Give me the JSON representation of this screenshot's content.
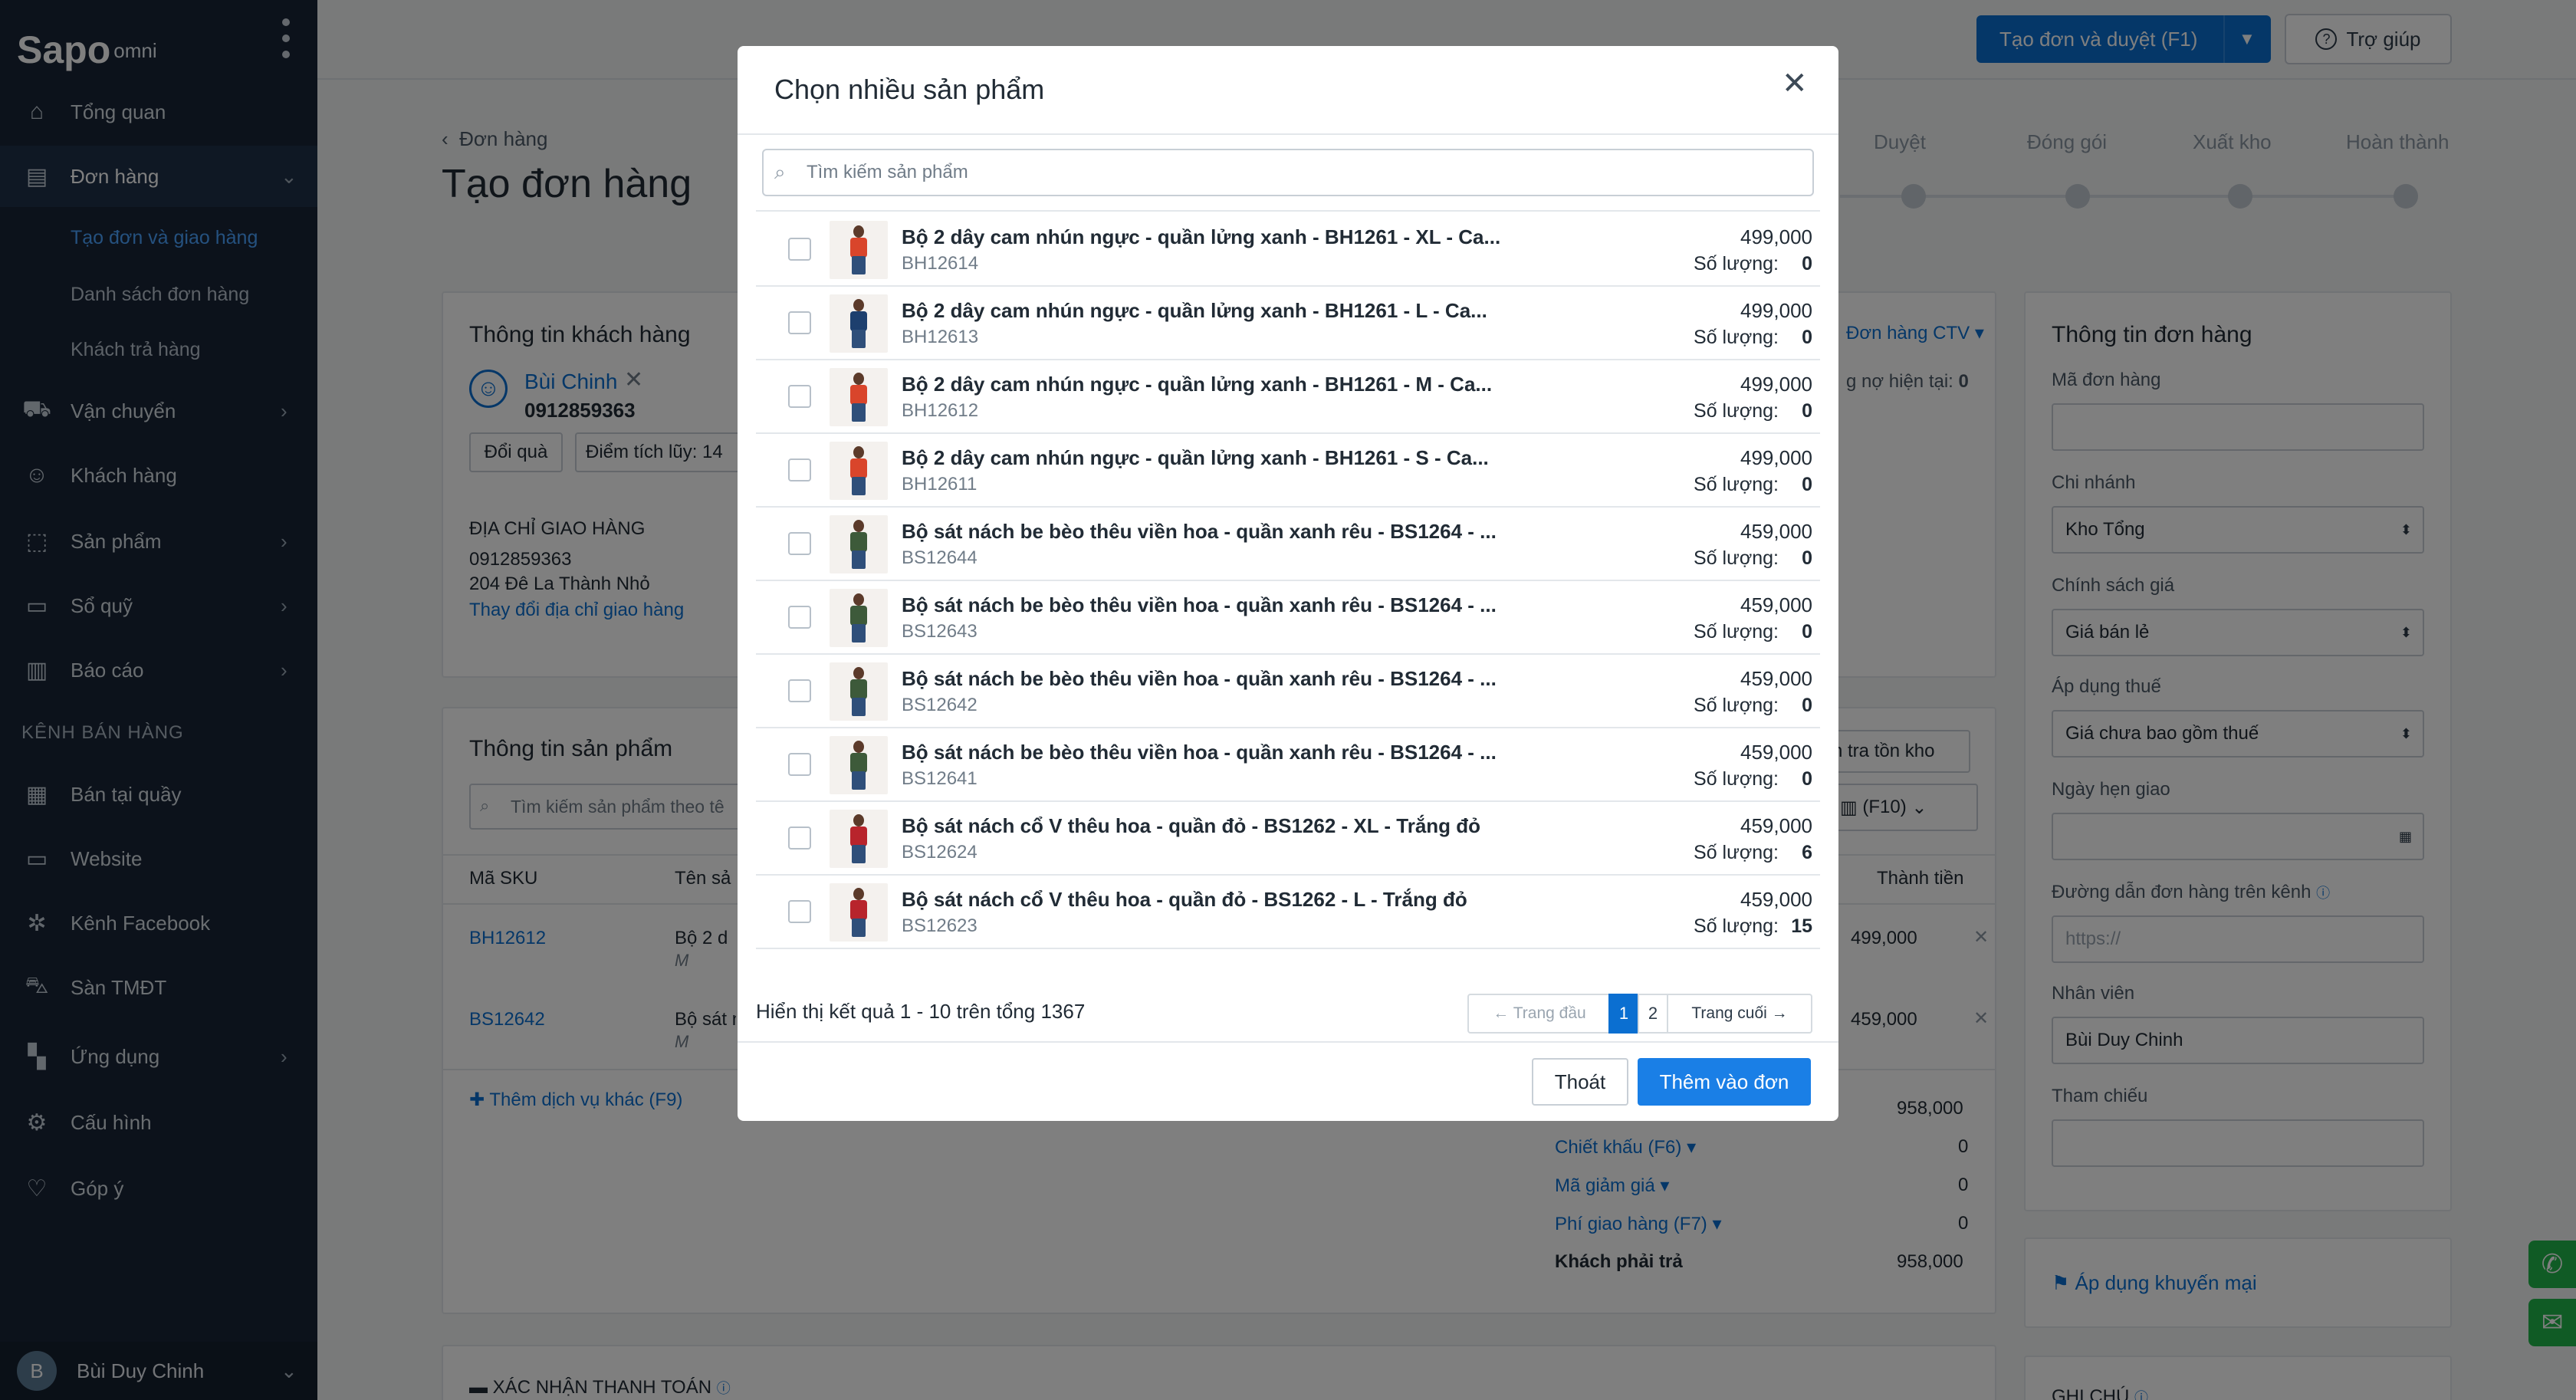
{
  "brand": {
    "logo_text": "Sapo",
    "logo_suffix": "omni"
  },
  "sidebar": {
    "items": [
      {
        "label": "Tổng quan",
        "icon": "home-icon"
      },
      {
        "label": "Đơn hàng",
        "icon": "order-icon"
      },
      {
        "label": "Vận chuyển",
        "icon": "truck-icon"
      },
      {
        "label": "Khách hàng",
        "icon": "user-icon"
      },
      {
        "label": "Sản phẩm",
        "icon": "box-icon"
      },
      {
        "label": "Sổ quỹ",
        "icon": "cash-icon"
      },
      {
        "label": "Báo cáo",
        "icon": "chart-icon"
      },
      {
        "label": "Bán tại quầy",
        "icon": "pos-icon"
      },
      {
        "label": "Website",
        "icon": "monitor-icon"
      },
      {
        "label": "Kênh Facebook",
        "icon": "network-icon"
      },
      {
        "label": "Sàn TMĐT",
        "icon": "cart-icon"
      },
      {
        "label": "Ứng dụng",
        "icon": "apps-icon"
      },
      {
        "label": "Cấu hình",
        "icon": "gear-icon"
      },
      {
        "label": "Góp ý",
        "icon": "feedback-icon"
      }
    ],
    "sub_items": [
      "Tạo đơn và giao hàng",
      "Danh sách đơn hàng",
      "Khách trả hàng"
    ],
    "section_label": "KÊNH BÁN HÀNG",
    "user": {
      "initial": "B",
      "name": "Bùi Duy Chinh"
    }
  },
  "topbar": {
    "primary_button": "Tạo đơn và duyệt (F1)",
    "help_button": "Trợ giúp"
  },
  "page": {
    "breadcrumb": "Đơn hàng",
    "title": "Tạo đơn hàng",
    "steps": [
      "Duyệt",
      "Đóng gói",
      "Xuất kho",
      "Hoàn thành"
    ]
  },
  "customer_card": {
    "title": "Thông tin khách hàng",
    "name": "Bùi Chinh",
    "phone": "0912859363",
    "gift_button": "Đổi quà",
    "points_label": "Điểm tích lũy: 14",
    "address_title": "ĐỊA CHỈ GIAO HÀNG",
    "address_phone": "0912859363",
    "address_line": "204 Đê La Thành Nhỏ",
    "change_address": "Thay đổi địa chỉ giao hàng",
    "ctv_label": "Đơn hàng CTV",
    "debt_label": "g nợ hiện tại:",
    "debt_value": "0"
  },
  "product_card": {
    "title": "Thông tin sản phẩm",
    "search_placeholder": "Tìm kiếm sản phẩm theo tê",
    "stock_button": "n tra tồn kho",
    "filter_button": "(F10)",
    "col_sku": "Mã SKU",
    "col_name": "Tên sả",
    "col_total": "Thành tiền",
    "lines": [
      {
        "sku": "BH12612",
        "name": "Bộ 2 d",
        "variant": "M",
        "total": "499,000"
      },
      {
        "sku": "BS12642",
        "name": "Bộ sát n",
        "variant": "M",
        "total": "459,000"
      }
    ],
    "add_service": "Thêm dịch vụ khác (F9)",
    "subtotal": "958,000",
    "discount_label": "Chiết khấu (F6)",
    "discount_value": "0",
    "coupon_label": "Mã giảm giá",
    "coupon_value": "0",
    "shipping_label": "Phí giao hàng (F7)",
    "shipping_value": "0",
    "pay_label": "Khách phải trả",
    "pay_value": "958,000"
  },
  "payment_card": {
    "title": "XÁC NHẬN THANH TOÁN"
  },
  "order_info": {
    "title": "Thông tin đơn hàng",
    "code_label": "Mã đơn hàng",
    "branch_label": "Chi nhánh",
    "branch_value": "Kho Tổng",
    "price_policy_label": "Chính sách giá",
    "price_policy_value": "Giá bán lẻ",
    "tax_label": "Áp dụng thuế",
    "tax_value": "Giá chưa bao gồm thuế",
    "date_label": "Ngày hẹn giao",
    "link_label": "Đường dẫn đơn hàng trên kênh",
    "link_placeholder": "https://",
    "staff_label": "Nhân viên",
    "staff_value": "Bùi Duy Chinh",
    "ref_label": "Tham chiếu",
    "promo": "Áp dụng khuyến mại",
    "note_title": "GHI CHÚ"
  },
  "modal": {
    "title": "Chọn nhiều sản phẩm",
    "search_placeholder": "Tìm kiếm sản phẩm",
    "qty_label": "Số lượng:",
    "products": [
      {
        "name": "Bộ 2 dây cam nhún ngực - quần lửng xanh - BH1261 - XL - Ca...",
        "sku": "BH12614",
        "price": "499,000",
        "qty": "0"
      },
      {
        "name": "Bộ 2 dây cam nhún ngực - quần lửng xanh - BH1261 - L - Ca...",
        "sku": "BH12613",
        "price": "499,000",
        "qty": "0"
      },
      {
        "name": "Bộ 2 dây cam nhún ngực - quần lửng xanh - BH1261 - M - Ca...",
        "sku": "BH12612",
        "price": "499,000",
        "qty": "0"
      },
      {
        "name": "Bộ 2 dây cam nhún ngực - quần lửng xanh - BH1261 - S - Ca...",
        "sku": "BH12611",
        "price": "499,000",
        "qty": "0"
      },
      {
        "name": "Bộ sát nách be bèo thêu viền hoa - quần xanh rêu - BS1264 - ...",
        "sku": "BS12644",
        "price": "459,000",
        "qty": "0"
      },
      {
        "name": "Bộ sát nách be bèo thêu viền hoa - quần xanh rêu - BS1264 - ...",
        "sku": "BS12643",
        "price": "459,000",
        "qty": "0"
      },
      {
        "name": "Bộ sát nách be bèo thêu viền hoa - quần xanh rêu - BS1264 - ...",
        "sku": "BS12642",
        "price": "459,000",
        "qty": "0"
      },
      {
        "name": "Bộ sát nách be bèo thêu viền hoa - quần xanh rêu - BS1264 - ...",
        "sku": "BS12641",
        "price": "459,000",
        "qty": "0"
      },
      {
        "name": "Bộ sát nách cổ V thêu hoa - quần đỏ - BS1262 - XL - Trắng đỏ",
        "sku": "BS12624",
        "price": "459,000",
        "qty": "6"
      },
      {
        "name": "Bộ sát nách cổ V thêu hoa - quần đỏ - BS1262 - L - Trắng đỏ",
        "sku": "BS12623",
        "price": "459,000",
        "qty": "15"
      }
    ],
    "result_text": "Hiển thị kết quả 1 - 10 trên tổng 1367",
    "pager": {
      "first": "← Trang đầu",
      "page1": "1",
      "page2": "2",
      "last": "Trang cuối →"
    },
    "exit_button": "Thoát",
    "add_button": "Thêm vào đơn"
  },
  "colors": {
    "sidebar_bg": "#182537",
    "primary": "#0b6fd1",
    "active_sub": "#4aa3ff",
    "float_green": "#20b64a"
  }
}
